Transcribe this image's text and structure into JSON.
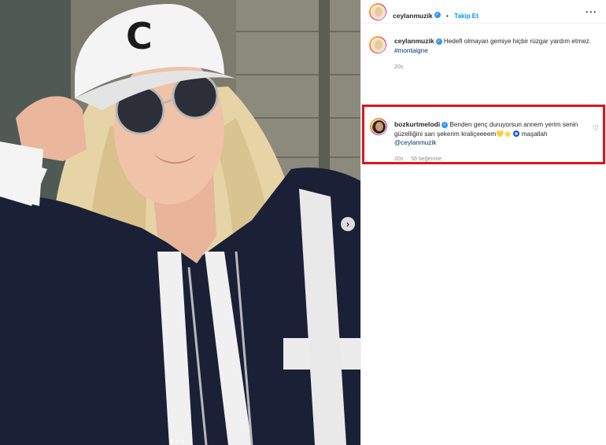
{
  "colors": {
    "accent": "#0095f6",
    "verified": "#3897f0",
    "highlight_border": "#e0141a",
    "hashtag": "#00376b",
    "muted": "#8e8e8e"
  },
  "post": {
    "author": "ceylanmuzik",
    "follow_label": "Takip Et",
    "separator": "•",
    "more_icon": "more-horizontal-icon",
    "caption": {
      "author": "ceylanmuzik",
      "text": "Hedefi olmayan gemiye hiçbir rüzgar yardım etmez.",
      "hashtag": "#montaigne",
      "time": "20s"
    },
    "carousel": {
      "next_icon": "chevron-right-icon",
      "dots": 3,
      "active_dot": 0
    }
  },
  "comment": {
    "author": "bozkurtmelodi",
    "text": "Benden genç duruyorsun annem yerim senin güzelliğini sarı şekerim kraliçeeeem",
    "emoji_1": "💛",
    "emoji_2": "⭐",
    "emoji_3": "nazar-bead-icon",
    "tail": "maşallah",
    "mention": "@ceylanmuzik",
    "time": "20s",
    "likes": "56 beğenme",
    "like_icon": "heart-icon"
  }
}
